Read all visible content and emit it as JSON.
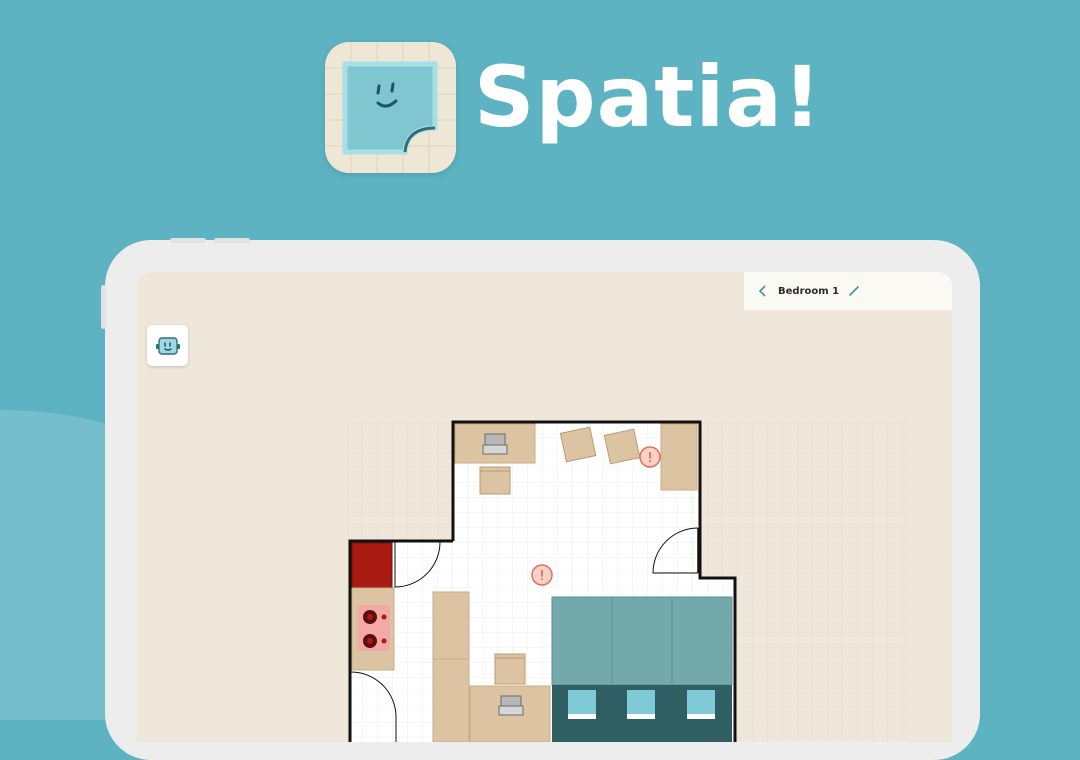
{
  "app": {
    "name": "Spatia!",
    "logo_icon": "smiling-square-face-icon",
    "brand_color": "#5db3c1"
  },
  "header": {
    "back_icon": "chevron-left-icon",
    "room_title": "Bedroom 1",
    "edit_icon": "pencil-icon"
  },
  "toolbar": {
    "assistant_icon": "robot-face-icon"
  },
  "floor_plan": {
    "warnings": [
      {
        "icon": "exclamation-icon",
        "label": "!"
      },
      {
        "icon": "exclamation-icon",
        "label": "!"
      }
    ],
    "furniture": [
      "desk-with-laptop",
      "chair",
      "chair",
      "chair",
      "warning",
      "cabinet",
      "door",
      "door",
      "door",
      "red-appliance",
      "stove",
      "wardrobe",
      "desk-with-laptop",
      "chair",
      "bed",
      "bed",
      "bed"
    ]
  }
}
